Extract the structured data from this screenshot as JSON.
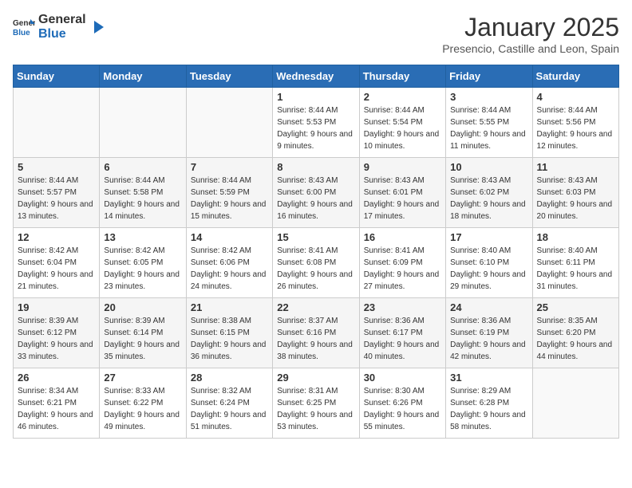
{
  "header": {
    "logo_general": "General",
    "logo_blue": "Blue",
    "month": "January 2025",
    "location": "Presencio, Castille and Leon, Spain"
  },
  "days_of_week": [
    "Sunday",
    "Monday",
    "Tuesday",
    "Wednesday",
    "Thursday",
    "Friday",
    "Saturday"
  ],
  "weeks": [
    [
      {
        "day": "",
        "sunrise": "",
        "sunset": "",
        "daylight": ""
      },
      {
        "day": "",
        "sunrise": "",
        "sunset": "",
        "daylight": ""
      },
      {
        "day": "",
        "sunrise": "",
        "sunset": "",
        "daylight": ""
      },
      {
        "day": "1",
        "sunrise": "Sunrise: 8:44 AM",
        "sunset": "Sunset: 5:53 PM",
        "daylight": "Daylight: 9 hours and 9 minutes."
      },
      {
        "day": "2",
        "sunrise": "Sunrise: 8:44 AM",
        "sunset": "Sunset: 5:54 PM",
        "daylight": "Daylight: 9 hours and 10 minutes."
      },
      {
        "day": "3",
        "sunrise": "Sunrise: 8:44 AM",
        "sunset": "Sunset: 5:55 PM",
        "daylight": "Daylight: 9 hours and 11 minutes."
      },
      {
        "day": "4",
        "sunrise": "Sunrise: 8:44 AM",
        "sunset": "Sunset: 5:56 PM",
        "daylight": "Daylight: 9 hours and 12 minutes."
      }
    ],
    [
      {
        "day": "5",
        "sunrise": "Sunrise: 8:44 AM",
        "sunset": "Sunset: 5:57 PM",
        "daylight": "Daylight: 9 hours and 13 minutes."
      },
      {
        "day": "6",
        "sunrise": "Sunrise: 8:44 AM",
        "sunset": "Sunset: 5:58 PM",
        "daylight": "Daylight: 9 hours and 14 minutes."
      },
      {
        "day": "7",
        "sunrise": "Sunrise: 8:44 AM",
        "sunset": "Sunset: 5:59 PM",
        "daylight": "Daylight: 9 hours and 15 minutes."
      },
      {
        "day": "8",
        "sunrise": "Sunrise: 8:43 AM",
        "sunset": "Sunset: 6:00 PM",
        "daylight": "Daylight: 9 hours and 16 minutes."
      },
      {
        "day": "9",
        "sunrise": "Sunrise: 8:43 AM",
        "sunset": "Sunset: 6:01 PM",
        "daylight": "Daylight: 9 hours and 17 minutes."
      },
      {
        "day": "10",
        "sunrise": "Sunrise: 8:43 AM",
        "sunset": "Sunset: 6:02 PM",
        "daylight": "Daylight: 9 hours and 18 minutes."
      },
      {
        "day": "11",
        "sunrise": "Sunrise: 8:43 AM",
        "sunset": "Sunset: 6:03 PM",
        "daylight": "Daylight: 9 hours and 20 minutes."
      }
    ],
    [
      {
        "day": "12",
        "sunrise": "Sunrise: 8:42 AM",
        "sunset": "Sunset: 6:04 PM",
        "daylight": "Daylight: 9 hours and 21 minutes."
      },
      {
        "day": "13",
        "sunrise": "Sunrise: 8:42 AM",
        "sunset": "Sunset: 6:05 PM",
        "daylight": "Daylight: 9 hours and 23 minutes."
      },
      {
        "day": "14",
        "sunrise": "Sunrise: 8:42 AM",
        "sunset": "Sunset: 6:06 PM",
        "daylight": "Daylight: 9 hours and 24 minutes."
      },
      {
        "day": "15",
        "sunrise": "Sunrise: 8:41 AM",
        "sunset": "Sunset: 6:08 PM",
        "daylight": "Daylight: 9 hours and 26 minutes."
      },
      {
        "day": "16",
        "sunrise": "Sunrise: 8:41 AM",
        "sunset": "Sunset: 6:09 PM",
        "daylight": "Daylight: 9 hours and 27 minutes."
      },
      {
        "day": "17",
        "sunrise": "Sunrise: 8:40 AM",
        "sunset": "Sunset: 6:10 PM",
        "daylight": "Daylight: 9 hours and 29 minutes."
      },
      {
        "day": "18",
        "sunrise": "Sunrise: 8:40 AM",
        "sunset": "Sunset: 6:11 PM",
        "daylight": "Daylight: 9 hours and 31 minutes."
      }
    ],
    [
      {
        "day": "19",
        "sunrise": "Sunrise: 8:39 AM",
        "sunset": "Sunset: 6:12 PM",
        "daylight": "Daylight: 9 hours and 33 minutes."
      },
      {
        "day": "20",
        "sunrise": "Sunrise: 8:39 AM",
        "sunset": "Sunset: 6:14 PM",
        "daylight": "Daylight: 9 hours and 35 minutes."
      },
      {
        "day": "21",
        "sunrise": "Sunrise: 8:38 AM",
        "sunset": "Sunset: 6:15 PM",
        "daylight": "Daylight: 9 hours and 36 minutes."
      },
      {
        "day": "22",
        "sunrise": "Sunrise: 8:37 AM",
        "sunset": "Sunset: 6:16 PM",
        "daylight": "Daylight: 9 hours and 38 minutes."
      },
      {
        "day": "23",
        "sunrise": "Sunrise: 8:36 AM",
        "sunset": "Sunset: 6:17 PM",
        "daylight": "Daylight: 9 hours and 40 minutes."
      },
      {
        "day": "24",
        "sunrise": "Sunrise: 8:36 AM",
        "sunset": "Sunset: 6:19 PM",
        "daylight": "Daylight: 9 hours and 42 minutes."
      },
      {
        "day": "25",
        "sunrise": "Sunrise: 8:35 AM",
        "sunset": "Sunset: 6:20 PM",
        "daylight": "Daylight: 9 hours and 44 minutes."
      }
    ],
    [
      {
        "day": "26",
        "sunrise": "Sunrise: 8:34 AM",
        "sunset": "Sunset: 6:21 PM",
        "daylight": "Daylight: 9 hours and 46 minutes."
      },
      {
        "day": "27",
        "sunrise": "Sunrise: 8:33 AM",
        "sunset": "Sunset: 6:22 PM",
        "daylight": "Daylight: 9 hours and 49 minutes."
      },
      {
        "day": "28",
        "sunrise": "Sunrise: 8:32 AM",
        "sunset": "Sunset: 6:24 PM",
        "daylight": "Daylight: 9 hours and 51 minutes."
      },
      {
        "day": "29",
        "sunrise": "Sunrise: 8:31 AM",
        "sunset": "Sunset: 6:25 PM",
        "daylight": "Daylight: 9 hours and 53 minutes."
      },
      {
        "day": "30",
        "sunrise": "Sunrise: 8:30 AM",
        "sunset": "Sunset: 6:26 PM",
        "daylight": "Daylight: 9 hours and 55 minutes."
      },
      {
        "day": "31",
        "sunrise": "Sunrise: 8:29 AM",
        "sunset": "Sunset: 6:28 PM",
        "daylight": "Daylight: 9 hours and 58 minutes."
      },
      {
        "day": "",
        "sunrise": "",
        "sunset": "",
        "daylight": ""
      }
    ]
  ]
}
